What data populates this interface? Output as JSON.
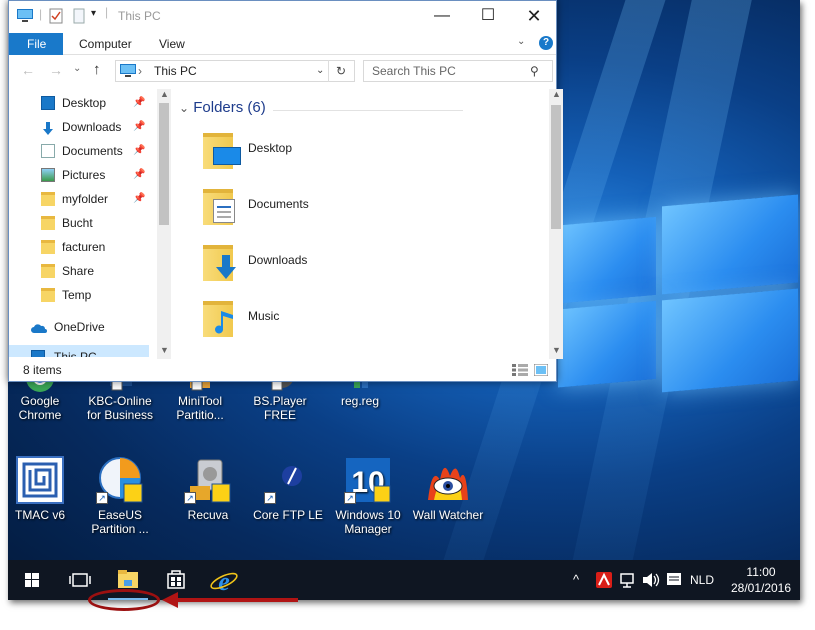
{
  "explorer": {
    "title": "This PC",
    "ribbon_tabs": [
      "File",
      "Computer",
      "View"
    ],
    "address": "This PC",
    "search_placeholder": "Search This PC",
    "nav_items": [
      {
        "label": "Desktop",
        "icon": "desktop-icon",
        "pinned": true
      },
      {
        "label": "Downloads",
        "icon": "download-icon",
        "pinned": true
      },
      {
        "label": "Documents",
        "icon": "documents-icon",
        "pinned": true
      },
      {
        "label": "Pictures",
        "icon": "pictures-icon",
        "pinned": true
      },
      {
        "label": "myfolder",
        "icon": "folder-icon",
        "pinned": true
      },
      {
        "label": "Bucht",
        "icon": "folder-icon",
        "pinned": false
      },
      {
        "label": "facturen",
        "icon": "folder-icon",
        "pinned": false
      },
      {
        "label": "Share",
        "icon": "folder-icon",
        "pinned": false
      },
      {
        "label": "Temp",
        "icon": "folder-icon",
        "pinned": false
      },
      {
        "label": "OneDrive",
        "icon": "cloud-icon",
        "pinned": false
      },
      {
        "label": "This PC",
        "icon": "computer-icon",
        "pinned": false
      }
    ],
    "section_header": "Folders (6)",
    "folders": [
      {
        "label": "Desktop",
        "icon": "desktop-folder-icon"
      },
      {
        "label": "Documents",
        "icon": "documents-folder-icon"
      },
      {
        "label": "Downloads",
        "icon": "downloads-folder-icon"
      },
      {
        "label": "Music",
        "icon": "music-folder-icon"
      }
    ],
    "status": "8 items"
  },
  "desktop_icons_row1": [
    {
      "label": "Google Chrome"
    },
    {
      "label": "KBC-Online for Business"
    },
    {
      "label": "MiniTool Partitio..."
    },
    {
      "label": "BS.Player FREE"
    },
    {
      "label": "reg.reg"
    }
  ],
  "desktop_icons_row2": [
    {
      "label": "TMAC v6"
    },
    {
      "label": "EaseUS Partition ..."
    },
    {
      "label": "Recuva"
    },
    {
      "label": "Core FTP LE"
    },
    {
      "label": "Windows 10 Manager"
    },
    {
      "label": "Wall Watcher"
    }
  ],
  "taskbar": {
    "language": "NLD",
    "time": "11:00",
    "date": "28/01/2016"
  },
  "colors": {
    "accent": "#1979ca",
    "annotation": "#b01414"
  }
}
